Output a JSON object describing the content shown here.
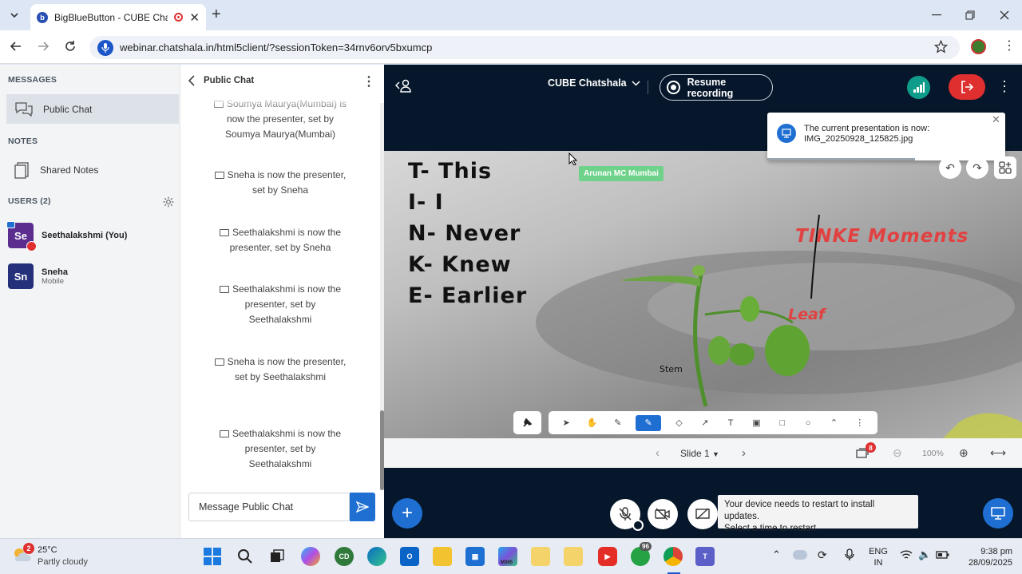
{
  "browser": {
    "tab_title": "BigBlueButton - CUBE Chats",
    "url": "webinar.chatshala.in/html5client/?sessionToken=34rnv6orv5bxumcp",
    "new_tab_label": "+"
  },
  "sidebar": {
    "messages_heading": "MESSAGES",
    "public_chat_label": "Public Chat",
    "notes_heading": "NOTES",
    "shared_notes_label": "Shared Notes",
    "users_heading": "USERS (2)",
    "users": [
      {
        "initials": "Se",
        "name": "Seethalakshmi (You)",
        "sub": "",
        "color": "#5a2d8f"
      },
      {
        "initials": "Sn",
        "name": "Sneha",
        "sub": "Mobile",
        "color": "#24307a"
      }
    ]
  },
  "chat": {
    "title": "Public Chat",
    "messages": [
      {
        "text": "Soumya Maurya(Mumbai) is now the presenter, set by Soumya Maurya(Mumbai)"
      },
      {
        "text": "Sneha is now the presenter, set by Sneha"
      },
      {
        "text": "Seethalakshmi is now the presenter, set by Sneha"
      },
      {
        "text": "Seethalakshmi is now the presenter, set by Seethalakshmi"
      },
      {
        "text": "Sneha is now the presenter, set by Seethalakshmi"
      },
      {
        "text": "Seethalakshmi is now the presenter, set by Seethalakshmi"
      }
    ],
    "input_placeholder": "Message Public Chat"
  },
  "meeting": {
    "title": "CUBE Chatshala",
    "record_label": "Resume recording",
    "toast_line1": "The current presentation is now:",
    "toast_line2": "IMG_20250928_125825.jpg",
    "presenter_label": "Arunan MC Mumbai",
    "slide_acronym": [
      "T- This",
      "I- I",
      "N- Never",
      "K- Knew",
      "E- Earlier"
    ],
    "annotation_title": "TINKE  Moments",
    "annotation_leaf": "Leaf",
    "annotation_stem": "Stem",
    "slide_label": "Slide 1",
    "zoom": "100%",
    "slides_badge": "8",
    "windows_toast_line1": "Your device needs to restart to install updates.",
    "windows_toast_line2": "Select a time to restart."
  },
  "taskbar": {
    "weather_badge": "2",
    "temperature": "25°C",
    "weather": "Partly cloudy",
    "whatsapp_badge": "96",
    "lang_top": "ENG",
    "lang_bottom": "IN",
    "time": "9:38 pm",
    "date": "28/09/2025",
    "m365_label": "M365"
  }
}
